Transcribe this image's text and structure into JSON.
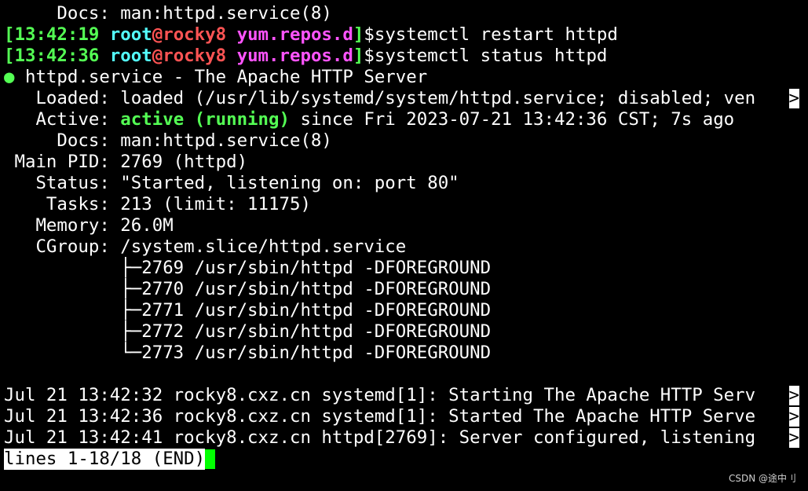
{
  "lines": {
    "docs_prev": "     Docs: man:httpd.service(8)",
    "prompt1": {
      "time": "[13:42:19",
      "user": " root",
      "at": "@",
      "host": "rocky8",
      "path": " yum.repos.d",
      "bracket": "]",
      "cmd": "$systemctl restart httpd"
    },
    "prompt2": {
      "time": "[13:42:36",
      "user": " root",
      "at": "@",
      "host": "rocky8",
      "path": " yum.repos.d",
      "bracket": "]",
      "cmd": "$systemctl status httpd"
    },
    "service_dot": "●",
    "service_title": " httpd.service - The Apache HTTP Server",
    "loaded": "   Loaded: loaded (/usr/lib/systemd/system/httpd.service; disabled; ven",
    "active_label": "   Active: ",
    "active_value": "active (running)",
    "active_rest": " since Fri 2023-07-21 13:42:36 CST; 7s ago",
    "docs": "     Docs: man:httpd.service(8)",
    "main_pid": " Main PID: 2769 (httpd)",
    "status": "   Status: \"Started, listening on: port 80\"",
    "tasks": "    Tasks: 213 (limit: 11175)",
    "memory": "   Memory: 26.0M",
    "cgroup": "   CGroup: /system.slice/httpd.service",
    "procs": [
      "           ├─2769 /usr/sbin/httpd -DFOREGROUND",
      "           ├─2770 /usr/sbin/httpd -DFOREGROUND",
      "           ├─2771 /usr/sbin/httpd -DFOREGROUND",
      "           ├─2772 /usr/sbin/httpd -DFOREGROUND",
      "           └─2773 /usr/sbin/httpd -DFOREGROUND"
    ],
    "logs": [
      "Jul 21 13:42:32 rocky8.cxz.cn systemd[1]: Starting The Apache HTTP Serv",
      "Jul 21 13:42:36 rocky8.cxz.cn systemd[1]: Started The Apache HTTP Serve",
      "Jul 21 13:42:41 rocky8.cxz.cn httpd[2769]: Server configured, listening"
    ],
    "truncation_marker": ">",
    "pager_status": "lines 1-18/18 (END)"
  },
  "watermark": "CSDN @途中刂",
  "colors": {
    "background": "#000000",
    "time": "#54ff54",
    "user": "#54ffff",
    "host": "#ff5454",
    "path": "#ff54ff",
    "active": "#54ff54",
    "cursor": "#00ff00"
  }
}
